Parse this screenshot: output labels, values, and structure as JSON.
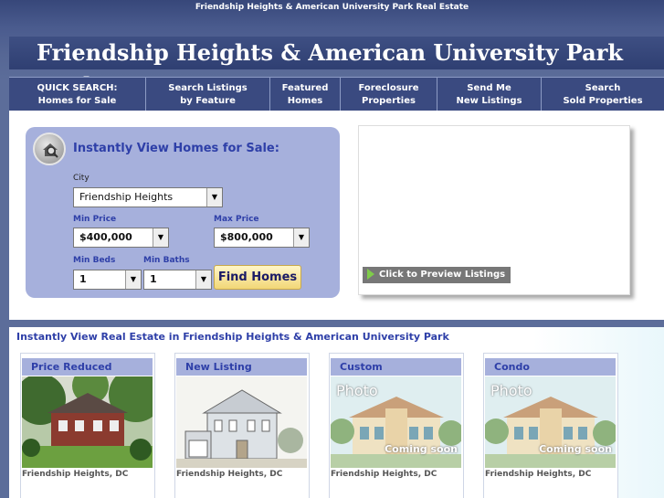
{
  "top_bar": {
    "title": "Friendship Heights & American University Park Real Estate"
  },
  "banner": {
    "title": "Friendship Heights & American University Park Real Estate"
  },
  "nav": [
    {
      "line1": "QUICK SEARCH:",
      "line2": "Homes for Sale"
    },
    {
      "line1": "Search Listings",
      "line2": "by Feature"
    },
    {
      "line1": "Featured",
      "line2": "Homes"
    },
    {
      "line1": "Foreclosure",
      "line2": "Properties"
    },
    {
      "line1": "Send Me",
      "line2": "New Listings"
    },
    {
      "line1": "Search",
      "line2": "Sold Properties"
    }
  ],
  "search": {
    "title": "Instantly View Homes for Sale:",
    "city_label": "City",
    "city_value": "Friendship Heights",
    "min_price_label": "Min Price",
    "min_price_value": "$400,000",
    "max_price_label": "Max Price",
    "max_price_value": "$800,000",
    "min_beds_label": "Min Beds",
    "min_beds_value": "1",
    "min_baths_label": "Min Baths",
    "min_baths_value": "1",
    "find_button": "Find Homes",
    "icon": "house-search-icon"
  },
  "preview": {
    "button": "Click to Preview Listings",
    "icon": "green-arrow-icon"
  },
  "listings": {
    "title": "Instantly View Real Estate in Friendship Heights & American University Park",
    "cards": [
      {
        "label": "Price Reduced",
        "location": "Friendship Heights, DC"
      },
      {
        "label": "New Listing",
        "location": "Friendship Heights, DC"
      },
      {
        "label": "Custom",
        "location": "Friendship Heights, DC",
        "overlay_top": "Photo",
        "overlay_bottom": "Coming soon"
      },
      {
        "label": "Condo",
        "location": "Friendship Heights, DC",
        "overlay_top": "Photo",
        "overlay_bottom": "Coming soon"
      }
    ]
  },
  "colors": {
    "accent": "#2e3fa8",
    "panel": "#a6b0dc",
    "nav_bg": "#3a4a80"
  }
}
